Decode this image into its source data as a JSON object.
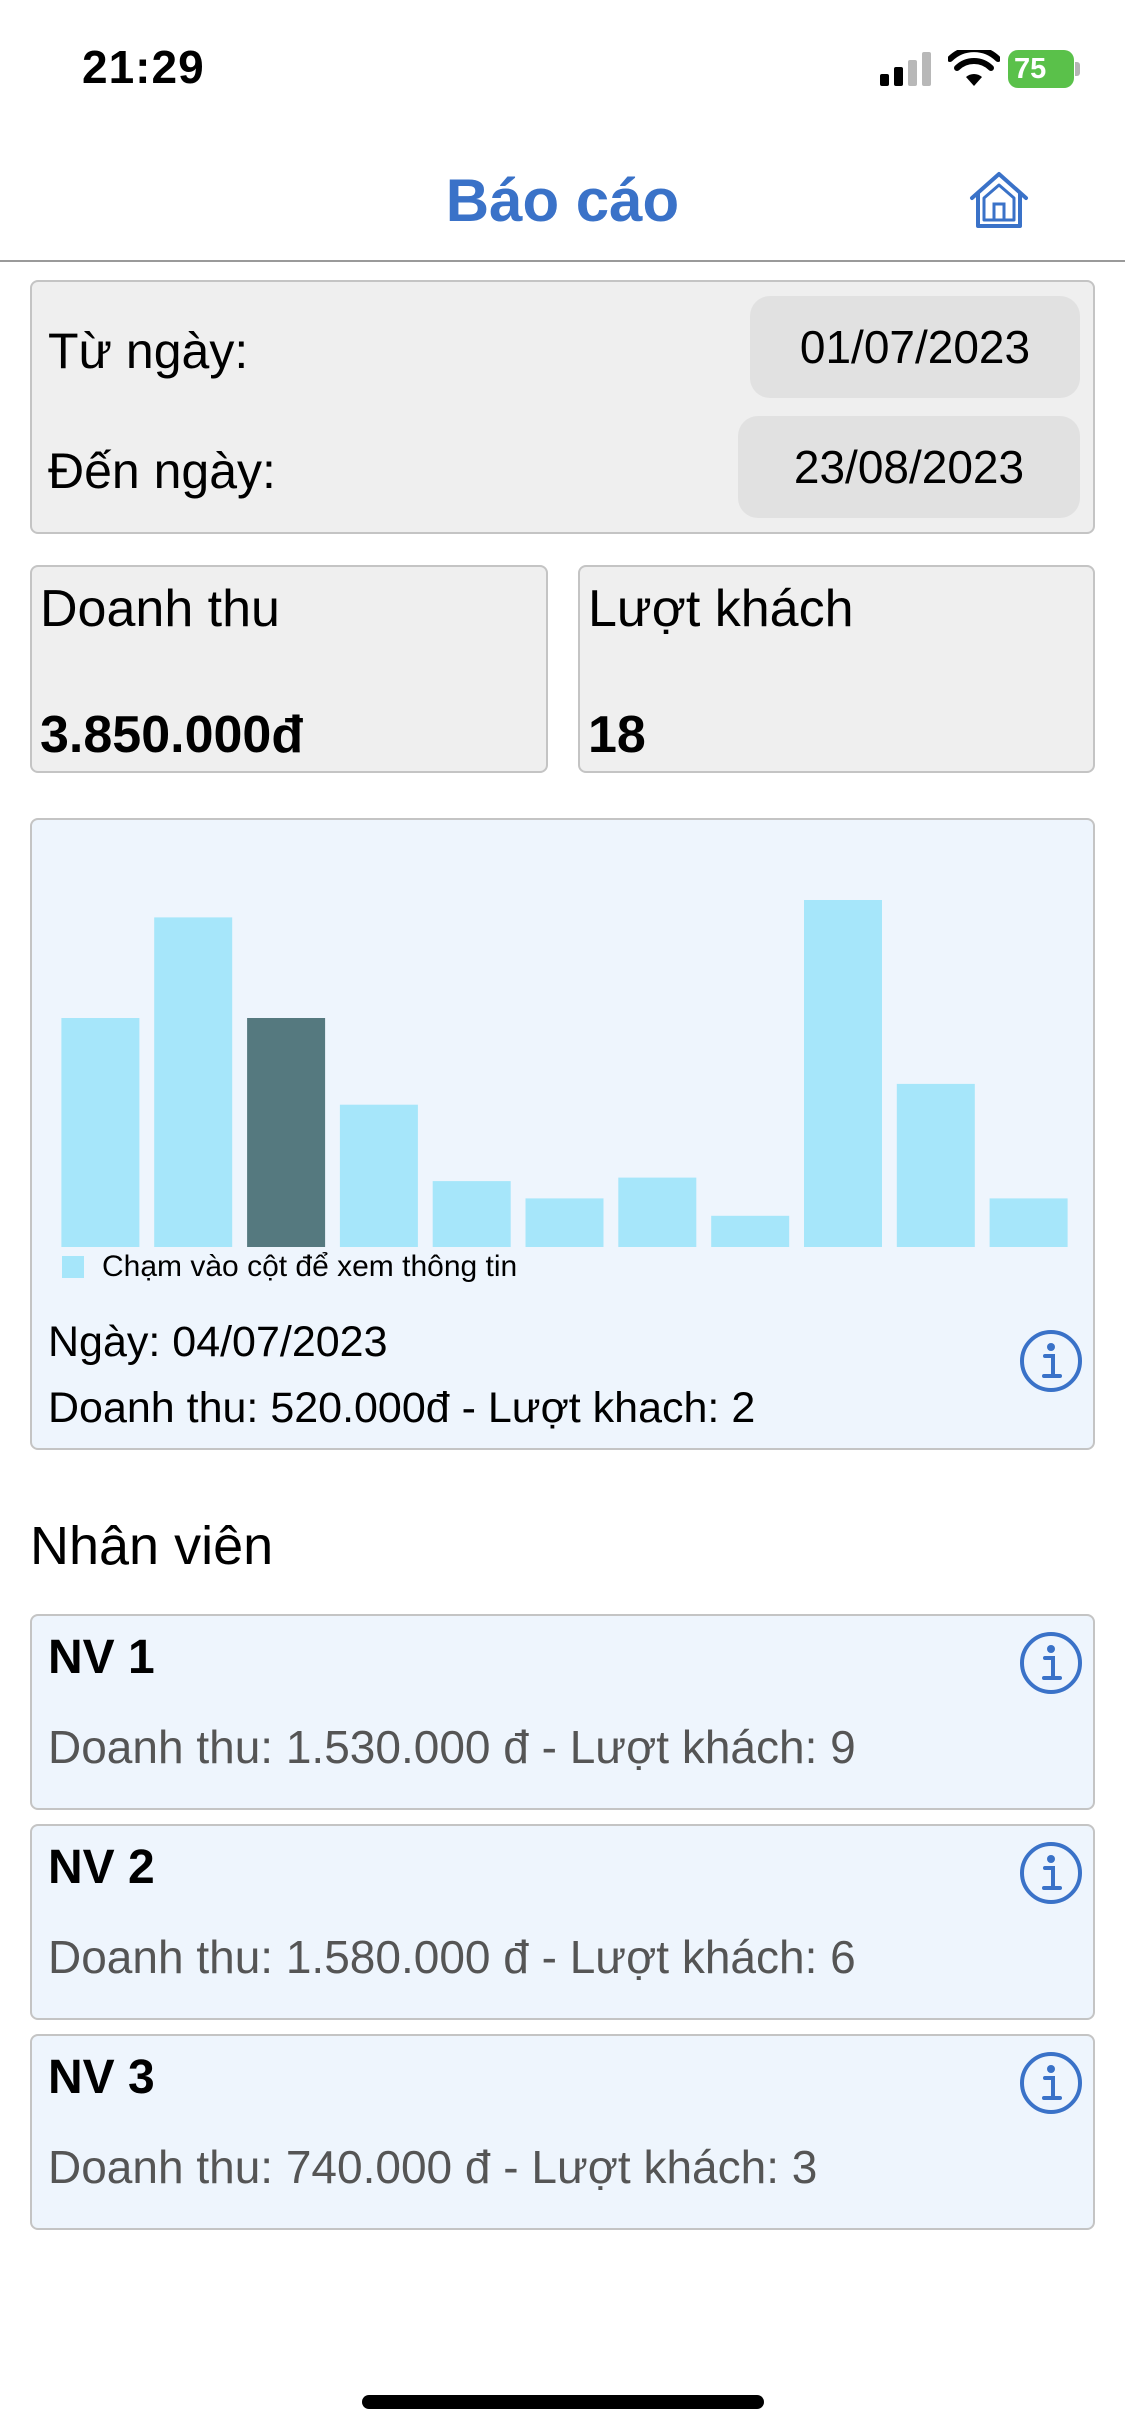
{
  "status_bar": {
    "time": "21:29",
    "battery": "75"
  },
  "header": {
    "title": "Báo cáo"
  },
  "date_range": {
    "from_label": "Từ ngày:",
    "from_value": "01/07/2023",
    "to_label": "Đến ngày:",
    "to_value": "23/08/2023"
  },
  "summary": {
    "revenue_label": "Doanh thu",
    "revenue_value": "3.850.000đ",
    "guests_label": "Lượt khách",
    "guests_value": "18"
  },
  "chart_data": {
    "type": "bar",
    "values": [
      0.66,
      0.95,
      0.66,
      0.41,
      0.19,
      0.14,
      0.2,
      0.09,
      1.0,
      0.47,
      0.14
    ],
    "ylim": [
      0,
      1
    ],
    "selected_index": 2,
    "legend": "Chạm vào cột để xem thông tin",
    "colors": {
      "bar": "#a6e6fa",
      "selected": "#55797f"
    }
  },
  "chart_info": {
    "date": "Ngày: 04/07/2023",
    "stats": "Doanh thu: 520.000đ - Lượt khach: 2"
  },
  "staff": {
    "title": "Nhân viên",
    "items": [
      {
        "name": "NV 1",
        "stats": "Doanh thu: 1.530.000 đ - Lượt khách: 9"
      },
      {
        "name": "NV 2",
        "stats": "Doanh thu: 1.580.000 đ - Lượt khách: 6"
      },
      {
        "name": "NV 3",
        "stats": "Doanh thu: 740.000 đ - Lượt khách: 3"
      }
    ]
  },
  "icons": {
    "home": "home-icon",
    "info": "info-icon"
  },
  "colors": {
    "accent": "#3a72c8",
    "card_bg": "#efefef",
    "chart_bg": "#eef5fd"
  }
}
